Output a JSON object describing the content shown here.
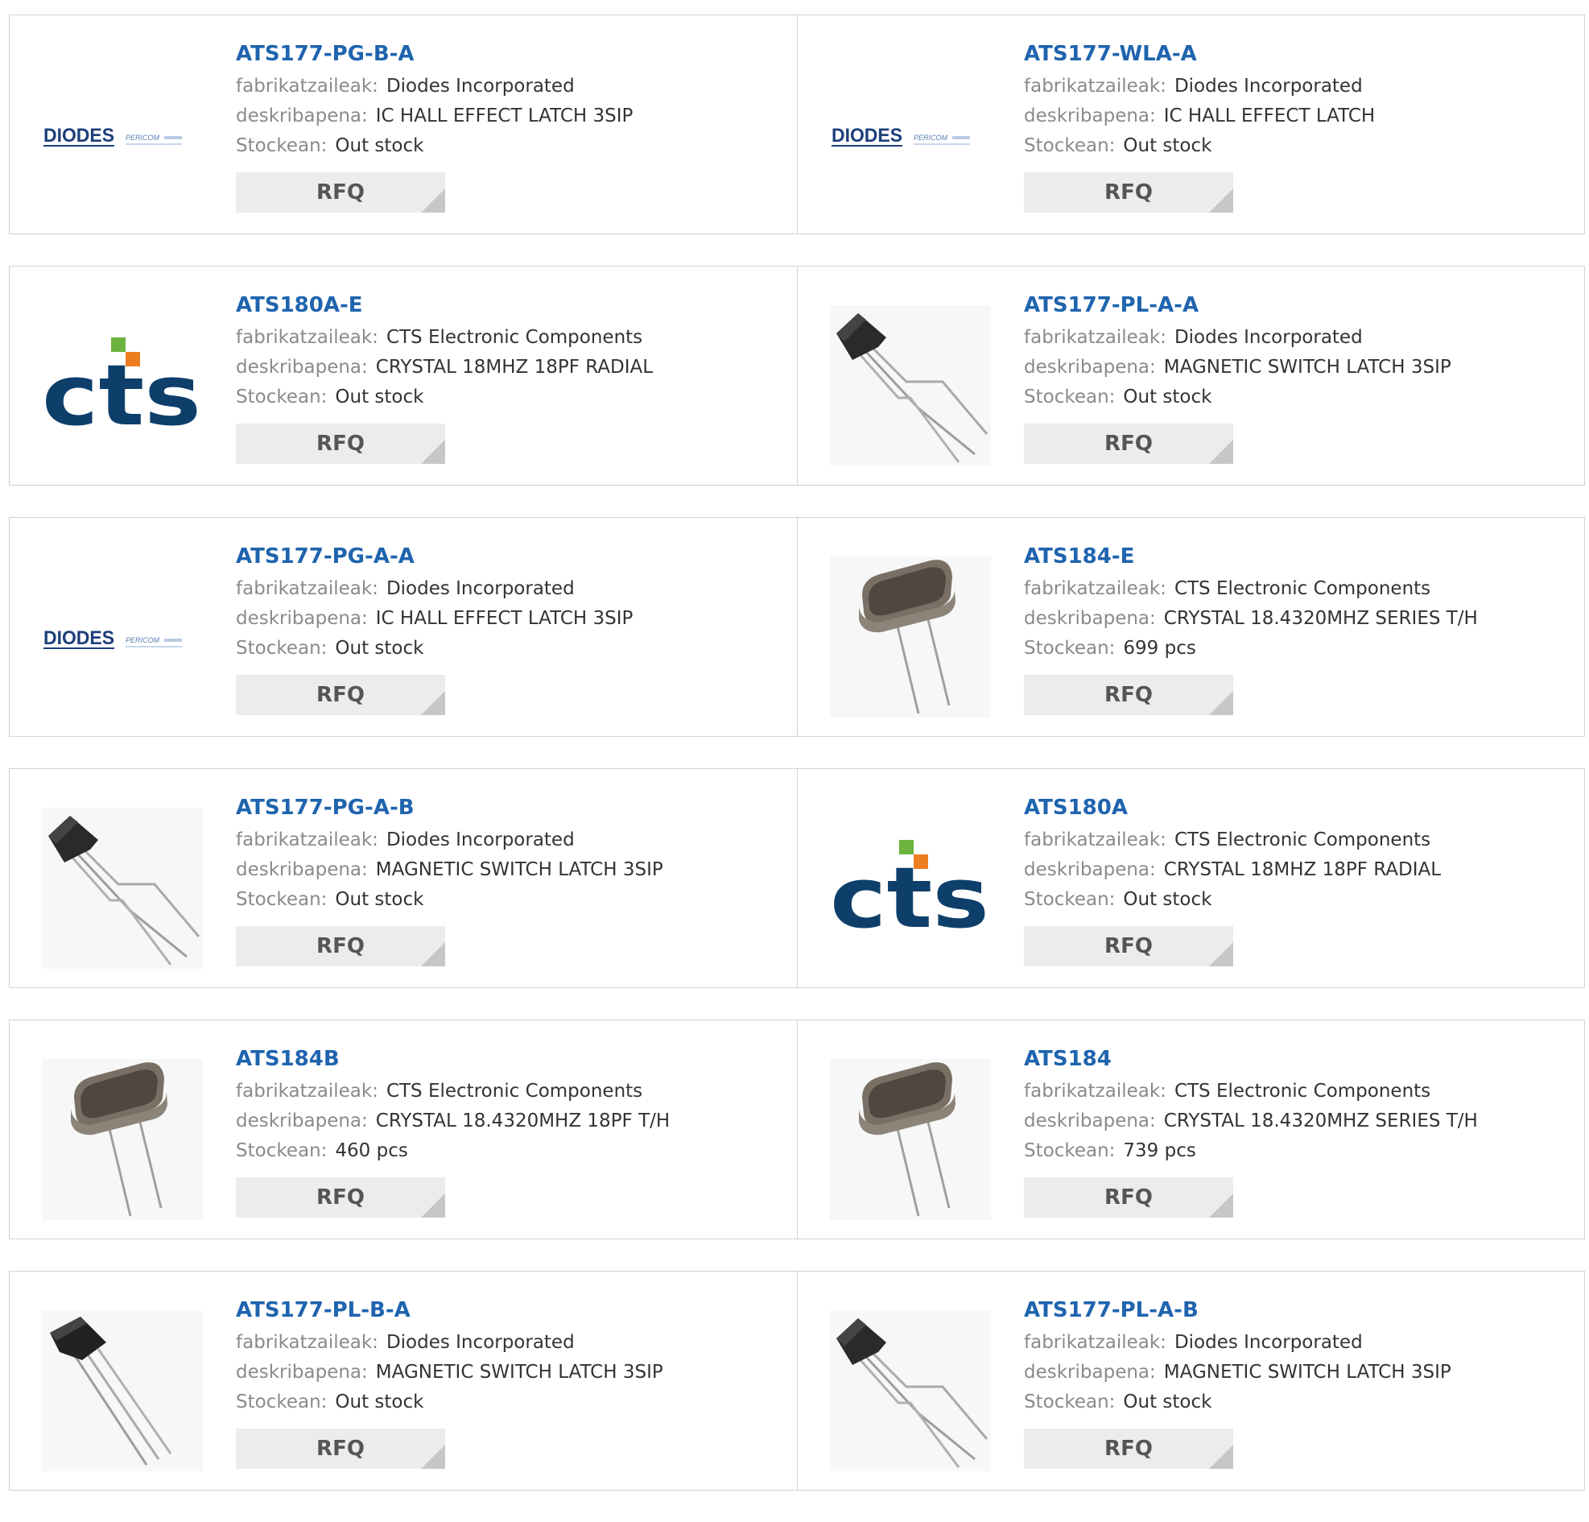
{
  "labels": {
    "manufacturer": "fabrikatzaileak:",
    "description": "deskribapena:",
    "stock": "Stockean:",
    "rfq": "RFQ"
  },
  "logos": {
    "diodes": "DIODES",
    "pericom": "PERICOM",
    "cts": "cts"
  },
  "colors": {
    "link": "#1f64ae",
    "cts_blue": "#0e3f6b",
    "cts_green": "#6cb33f",
    "cts_orange": "#ee7d22"
  },
  "products": [
    {
      "part": "ATS177-PG-B-A",
      "manufacturer": "Diodes Incorporated",
      "description": "IC HALL EFFECT LATCH 3SIP",
      "stock": "Out stock",
      "image": "diodes-logo"
    },
    {
      "part": "ATS177-WLA-A",
      "manufacturer": "Diodes Incorporated",
      "description": "IC HALL EFFECT LATCH",
      "stock": "Out stock",
      "image": "diodes-logo"
    },
    {
      "part": "ATS180A-E",
      "manufacturer": "CTS Electronic Components",
      "description": "CRYSTAL 18MHZ 18PF RADIAL",
      "stock": "Out stock",
      "image": "cts-logo"
    },
    {
      "part": "ATS177-PL-A-A",
      "manufacturer": "Diodes Incorporated",
      "description": "MAGNETIC SWITCH LATCH 3SIP",
      "stock": "Out stock",
      "image": "hall-sensor"
    },
    {
      "part": "ATS177-PG-A-A",
      "manufacturer": "Diodes Incorporated",
      "description": "IC HALL EFFECT LATCH 3SIP",
      "stock": "Out stock",
      "image": "diodes-logo"
    },
    {
      "part": "ATS184-E",
      "manufacturer": "CTS Electronic Components",
      "description": "CRYSTAL 18.4320MHZ SERIES T/H",
      "stock": "699 pcs",
      "image": "crystal"
    },
    {
      "part": "ATS177-PG-A-B",
      "manufacturer": "Diodes Incorporated",
      "description": "MAGNETIC SWITCH LATCH 3SIP",
      "stock": "Out stock",
      "image": "hall-sensor"
    },
    {
      "part": "ATS180A",
      "manufacturer": "CTS Electronic Components",
      "description": "CRYSTAL 18MHZ 18PF RADIAL",
      "stock": "Out stock",
      "image": "cts-logo"
    },
    {
      "part": "ATS184B",
      "manufacturer": "CTS Electronic Components",
      "description": "CRYSTAL 18.4320MHZ 18PF T/H",
      "stock": "460 pcs",
      "image": "crystal"
    },
    {
      "part": "ATS184",
      "manufacturer": "CTS Electronic Components",
      "description": "CRYSTAL 18.4320MHZ SERIES T/H",
      "stock": "739 pcs",
      "image": "crystal"
    },
    {
      "part": "ATS177-PL-B-A",
      "manufacturer": "Diodes Incorporated",
      "description": "MAGNETIC SWITCH LATCH 3SIP",
      "stock": "Out stock",
      "image": "hall-sensor-straight"
    },
    {
      "part": "ATS177-PL-A-B",
      "manufacturer": "Diodes Incorporated",
      "description": "MAGNETIC SWITCH LATCH 3SIP",
      "stock": "Out stock",
      "image": "hall-sensor"
    }
  ]
}
